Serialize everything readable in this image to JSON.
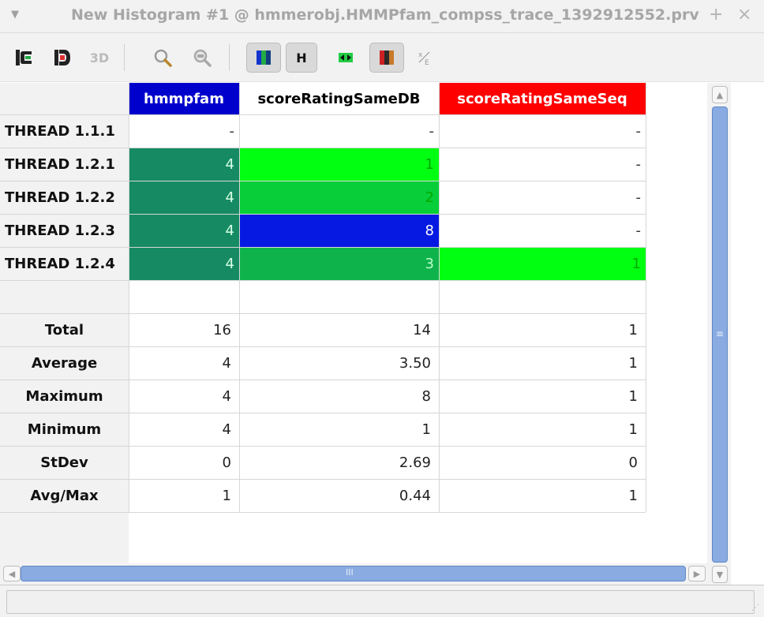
{
  "window": {
    "menu_glyph": "▼",
    "title": "New Histogram #1 @ hmmerobj.HMMPfam_compss_trace_1392912552.prv",
    "add_glyph": "+",
    "close_glyph": "×"
  },
  "toolbar": {
    "label_3d": "3D",
    "label_h": "H",
    "icons": [
      "open-control-window-icon",
      "open-data-window-icon",
      "3d-view-icon",
      "zoom-icon",
      "zoom-reset-icon",
      "color-mode-icon",
      "horizontal-mode-icon",
      "hide-empty-columns-icon",
      "gradient-color-icon",
      "label-format-icon"
    ]
  },
  "table": {
    "columns": [
      {
        "label": "hmmpfam",
        "bg": "#0000cc",
        "fg": "#ffffff"
      },
      {
        "label": "scoreRatingSameDB",
        "bg": "#ffffff",
        "fg": "#000000"
      },
      {
        "label": "scoreRatingSameSeq",
        "bg": "#ff0000",
        "fg": "#ffffff"
      }
    ],
    "rows": [
      {
        "label": "THREAD 1.1.1",
        "cells": [
          {
            "v": "-",
            "bg": "#ffffff",
            "fg": "#333333"
          },
          {
            "v": "-",
            "bg": "#ffffff",
            "fg": "#333333"
          },
          {
            "v": "-",
            "bg": "#ffffff",
            "fg": "#333333"
          }
        ]
      },
      {
        "label": "THREAD 1.2.1",
        "cells": [
          {
            "v": "4",
            "bg": "#168b63",
            "fg": "#d6ffe6"
          },
          {
            "v": "1",
            "bg": "#00ff11",
            "fg": "#00aa00"
          },
          {
            "v": "-",
            "bg": "#ffffff",
            "fg": "#333333"
          }
        ]
      },
      {
        "label": "THREAD 1.2.2",
        "cells": [
          {
            "v": "4",
            "bg": "#168b63",
            "fg": "#d6ffe6"
          },
          {
            "v": "2",
            "bg": "#07ce39",
            "fg": "#00aa00"
          },
          {
            "v": "-",
            "bg": "#ffffff",
            "fg": "#333333"
          }
        ]
      },
      {
        "label": "THREAD 1.2.3",
        "cells": [
          {
            "v": "4",
            "bg": "#168b63",
            "fg": "#d6ffe6"
          },
          {
            "v": "8",
            "bg": "#0519e2",
            "fg": "#ffffff"
          },
          {
            "v": "-",
            "bg": "#ffffff",
            "fg": "#333333"
          }
        ]
      },
      {
        "label": "THREAD 1.2.4",
        "cells": [
          {
            "v": "4",
            "bg": "#168b63",
            "fg": "#d6ffe6"
          },
          {
            "v": "3",
            "bg": "#0fb34c",
            "fg": "#b8ffc8"
          },
          {
            "v": "1",
            "bg": "#00ff11",
            "fg": "#00aa00"
          }
        ]
      }
    ],
    "stats": [
      {
        "label": "Total",
        "values": [
          "16",
          "14",
          "1"
        ]
      },
      {
        "label": "Average",
        "values": [
          "4",
          "3.50",
          "1"
        ]
      },
      {
        "label": "Maximum",
        "values": [
          "4",
          "8",
          "1"
        ]
      },
      {
        "label": "Minimum",
        "values": [
          "4",
          "1",
          "1"
        ]
      },
      {
        "label": "StDev",
        "values": [
          "0",
          "2.69",
          "0"
        ]
      },
      {
        "label": "Avg/Max",
        "values": [
          "1",
          "0.44",
          "1"
        ]
      }
    ]
  },
  "scrollbars": {
    "up_glyph": "▲",
    "down_glyph": "▼",
    "left_glyph": "◀",
    "right_glyph": "▶",
    "grip_v": "≡",
    "grip_h": "III"
  },
  "statusbar": {
    "text": "",
    "grip": "⋰"
  }
}
